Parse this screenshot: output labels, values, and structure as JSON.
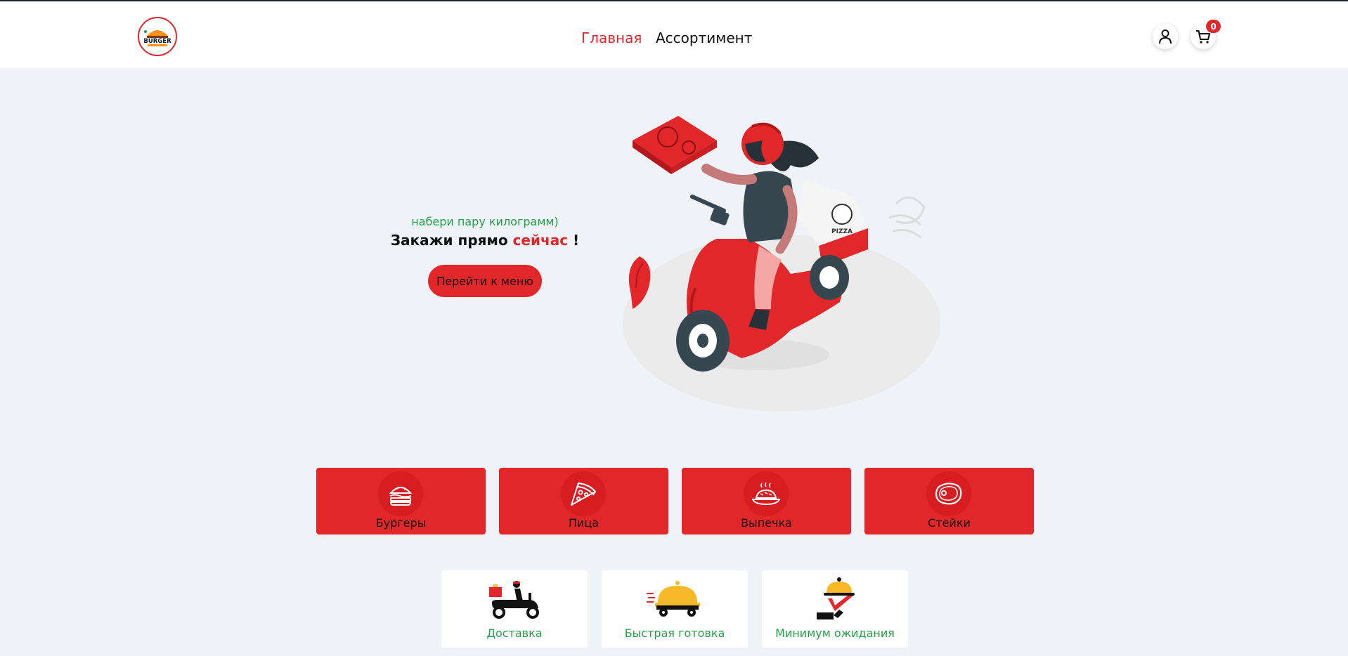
{
  "header": {
    "logo_text": "BURGER",
    "nav": [
      {
        "label": "Главная",
        "active": true
      },
      {
        "label": "Ассортимент",
        "active": false
      }
    ],
    "user_icon": "user-icon",
    "cart_icon": "cart-icon",
    "cart_count": "0"
  },
  "hero": {
    "subtitle": "набери пару килограмм)",
    "title_before": "Закажи прямо ",
    "title_accent": "сейчас",
    "title_after": " !",
    "button_label": "Перейти к меню",
    "art_text": "PIZZA"
  },
  "categories": [
    {
      "label": "Бургеры",
      "icon": "burger-icon"
    },
    {
      "label": "Пица",
      "icon": "pizza-icon"
    },
    {
      "label": "Выпечка",
      "icon": "pastry-icon"
    },
    {
      "label": "Стейки",
      "icon": "steak-icon"
    }
  ],
  "features": [
    {
      "label": "Доставка",
      "icon": "delivery-scooter-icon"
    },
    {
      "label": "Быстрая готовка",
      "icon": "fast-cloche-icon"
    },
    {
      "label": "Минимум ожидания",
      "icon": "serving-cloche-icon"
    }
  ],
  "colors": {
    "accent": "#e2272b",
    "green": "#22a046",
    "background": "#eff2f7",
    "yellow": "#f7b928"
  }
}
